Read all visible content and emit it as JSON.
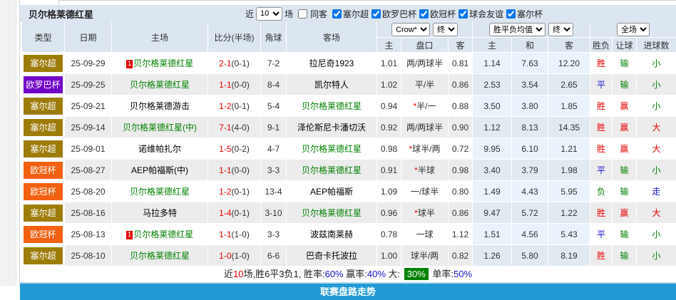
{
  "title": "贝尔格莱德红星",
  "filter_bar": {
    "near_label": "近",
    "games_count": "10",
    "games_label": "场",
    "same_away_label": "同客",
    "same_away_checked": false,
    "leagues": [
      {
        "label": "塞尔超",
        "checked": true
      },
      {
        "label": "欧罗巴杯",
        "checked": true
      },
      {
        "label": "欧冠杯",
        "checked": true
      },
      {
        "label": "球会友谊",
        "checked": true
      },
      {
        "label": "塞尔杯",
        "checked": true
      }
    ]
  },
  "header": {
    "main_columns": [
      "类型",
      "日期",
      "主场",
      "比分(半场)",
      "角球",
      "客场"
    ],
    "sub_columns": [
      "主",
      "盘口",
      "客",
      "主",
      "和",
      "客",
      "胜负",
      "让球",
      "进球数"
    ],
    "selectors": {
      "company": "Crow*",
      "company_stage": "终",
      "odds_avg": "胜平负均值",
      "odds_stage": "终",
      "scope": "全场"
    }
  },
  "rows": [
    {
      "type": "塞尔超",
      "date": "25-09-29",
      "home": "贝尔格莱德红星",
      "home_focus": true,
      "home_badge": "1",
      "score": "2-1",
      "half": "(0-1)",
      "corner": "7-2",
      "away": "拉尼奇1923",
      "away_focus": false,
      "odds_home": "1.01",
      "handicap": "两/两球半",
      "handicap_star": false,
      "odds_away": "0.81",
      "win": "1.14",
      "draw": "7.63",
      "lose": "12.20",
      "result": "胜",
      "handicap_result": "输",
      "goals": "小"
    },
    {
      "type": "欧罗巴杯",
      "date": "25-09-25",
      "home": "贝尔格莱德红星",
      "home_focus": true,
      "home_badge": "",
      "score": "1-1",
      "half": "(0-0)",
      "corner": "8-4",
      "away": "凯尔特人",
      "away_focus": false,
      "odds_home": "1.02",
      "handicap": "平/半",
      "handicap_star": false,
      "odds_away": "0.86",
      "win": "2.53",
      "draw": "3.54",
      "lose": "2.65",
      "result": "平",
      "handicap_result": "输",
      "goals": "小"
    },
    {
      "type": "塞尔超",
      "date": "25-09-21",
      "home": "贝尔格莱德游击",
      "home_focus": false,
      "home_badge": "",
      "score": "1-2",
      "half": "(0-1)",
      "corner": "5-4",
      "away": "贝尔格莱德红星",
      "away_focus": true,
      "odds_home": "0.94",
      "handicap": "半/一",
      "handicap_star": true,
      "odds_away": "0.88",
      "win": "3.50",
      "draw": "3.80",
      "lose": "1.85",
      "result": "胜",
      "handicap_result": "赢",
      "goals": "小"
    },
    {
      "type": "塞尔超",
      "date": "25-09-14",
      "home": "贝尔格莱德红星(中)",
      "home_focus": true,
      "home_badge": "",
      "score": "7-1",
      "half": "(4-0)",
      "corner": "9-1",
      "away": "泽伦斯尼卡潘切沃",
      "away_focus": false,
      "odds_home": "0.92",
      "handicap": "两/两球半",
      "handicap_star": false,
      "odds_away": "0.90",
      "win": "1.12",
      "draw": "8.13",
      "lose": "14.35",
      "result": "胜",
      "handicap_result": "赢",
      "goals": "大"
    },
    {
      "type": "塞尔超",
      "date": "25-09-01",
      "home": "诺维帕扎尔",
      "home_focus": false,
      "home_badge": "",
      "score": "1-5",
      "half": "(0-2)",
      "corner": "4-7",
      "away": "贝尔格莱德红星",
      "away_focus": true,
      "odds_home": "0.98",
      "handicap": "球半/两",
      "handicap_star": true,
      "odds_away": "0.72",
      "win": "9.95",
      "draw": "6.10",
      "lose": "1.21",
      "result": "胜",
      "handicap_result": "赢",
      "goals": "大"
    },
    {
      "type": "欧冠杯",
      "date": "25-08-27",
      "home": "AEP帕福斯(中)",
      "home_focus": false,
      "home_badge": "",
      "score": "1-1",
      "half": "(0-0)",
      "corner": "3-3",
      "away": "贝尔格莱德红星",
      "away_focus": true,
      "odds_home": "0.91",
      "handicap": "半球",
      "handicap_star": true,
      "odds_away": "0.98",
      "win": "3.40",
      "draw": "3.79",
      "lose": "1.98",
      "result": "平",
      "handicap_result": "输",
      "goals": "小"
    },
    {
      "type": "欧冠杯",
      "date": "25-08-20",
      "home": "贝尔格莱德红星",
      "home_focus": true,
      "home_badge": "",
      "score": "1-2",
      "half": "(0-1)",
      "corner": "13-4",
      "away": "AEP帕福斯",
      "away_focus": false,
      "odds_home": "1.09",
      "handicap": "一/球半",
      "handicap_star": false,
      "odds_away": "0.80",
      "win": "1.49",
      "draw": "4.43",
      "lose": "5.95",
      "result": "负",
      "handicap_result": "输",
      "goals": "走"
    },
    {
      "type": "塞尔超",
      "date": "25-08-16",
      "home": "马拉多特",
      "home_focus": false,
      "home_badge": "",
      "score": "1-4",
      "half": "(0-1)",
      "corner": "3-10",
      "away": "贝尔格莱德红星",
      "away_focus": true,
      "odds_home": "0.96",
      "handicap": "球半",
      "handicap_star": true,
      "odds_away": "0.86",
      "win": "9.47",
      "draw": "5.72",
      "lose": "1.22",
      "result": "胜",
      "handicap_result": "赢",
      "goals": "大"
    },
    {
      "type": "欧冠杯",
      "date": "25-08-13",
      "home": "贝尔格莱德红星",
      "home_focus": true,
      "home_badge": "1",
      "score": "1-1",
      "half": "(1-0)",
      "corner": "3-3",
      "away": "波兹南莱赫",
      "away_focus": false,
      "odds_home": "0.78",
      "handicap": "一球",
      "handicap_star": false,
      "odds_away": "1.12",
      "win": "1.51",
      "draw": "4.56",
      "lose": "5.43",
      "result": "平",
      "handicap_result": "输",
      "goals": "小"
    },
    {
      "type": "塞尔超",
      "date": "25-08-10",
      "home": "贝尔格莱德红星",
      "home_focus": true,
      "home_badge": "",
      "score": "1-0",
      "half": "(1-0)",
      "corner": "6-6",
      "away": "巴奇卡托波拉",
      "away_focus": false,
      "odds_home": "1.00",
      "handicap": "球半/两",
      "handicap_star": false,
      "odds_away": "0.82",
      "win": "1.26",
      "draw": "5.80",
      "lose": "8.19",
      "result": "胜",
      "handicap_result": "输",
      "goals": "小"
    }
  ],
  "summary_segments": [
    {
      "text": "近",
      "style": "plain"
    },
    {
      "text": "10",
      "style": "red"
    },
    {
      "text": "场,胜6平3负1, 胜率:",
      "style": "plain"
    },
    {
      "text": "60%",
      "style": "blue"
    },
    {
      "text": " 赢率:",
      "style": "plain"
    },
    {
      "text": "40%",
      "style": "blue"
    },
    {
      "text": " 大: ",
      "style": "plain"
    },
    {
      "text": "30%",
      "style": "badge"
    },
    {
      "text": " 单率:",
      "style": "plain"
    },
    {
      "text": "50%",
      "style": "blue"
    }
  ],
  "footer": {
    "label": "联赛盘路走势"
  },
  "theme": {
    "palette": {
      "red": "#e60000",
      "green": "#008000",
      "blue": "#1414cc"
    },
    "league_colors": {
      "塞尔超": "#9d7c0a",
      "欧罗巴杯": "#7101c8",
      "欧冠杯": "#f26011"
    },
    "value_colors": {
      "胜": "red",
      "平": "blue",
      "负": "green",
      "赢": "red",
      "输": "green",
      "大": "red",
      "小": "green",
      "走": "blue"
    },
    "accent": {
      "header_bg": "#dce6f1",
      "footer_bar": "#2199d4",
      "row_even": "#ececec",
      "odds_tint_odd": "#eaf3fb",
      "odds_tint_even": "#e1eaf1",
      "checkbox_blue": "#0b76ef",
      "summary_badge_bg": "#008000"
    }
  }
}
